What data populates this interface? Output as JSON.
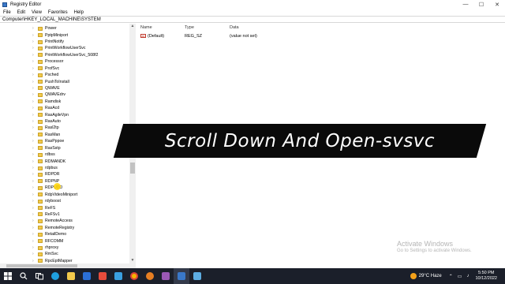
{
  "window": {
    "title": "Registry Editor",
    "controls": {
      "minimize": "—",
      "maximize": "☐",
      "close": "✕"
    }
  },
  "menu": [
    "File",
    "Edit",
    "View",
    "Favorites",
    "Help"
  ],
  "address": "Computer\\HKEY_LOCAL_MACHINE\\SYSTEM",
  "tree": {
    "items": [
      "Power",
      "PptpMiniport",
      "PrintNotify",
      "PrintWorkflowUserSvc",
      "PrintWorkflowUserSvc_508f2",
      "Processor",
      "ProfSvc",
      "Psched",
      "PushToInstall",
      "QWAVE",
      "QWAVEdrv",
      "Ramdisk",
      "RasAcd",
      "RasAgileVpn",
      "RasAuto",
      "Rasl2tp",
      "RasMan",
      "RasPppoe",
      "RasSstp",
      "rdbss",
      "RDMANDK",
      "rdpbus",
      "RDPDR",
      "RDPNP",
      "RDPUDD",
      "RdpVideoMiniport",
      "rdyboost",
      "ReFS",
      "ReFSv1",
      "RemoteAccess",
      "RemoteRegistry",
      "RetailDemo",
      "RFCOMM",
      "rhproxy",
      "RmSvc",
      "RpcEptMapper"
    ]
  },
  "list": {
    "headers": {
      "name": "Name",
      "type": "Type",
      "data": "Data"
    },
    "rows": [
      {
        "name": "(Default)",
        "type": "REG_SZ",
        "data": "(value not set)",
        "icon": "ab"
      }
    ]
  },
  "banner": {
    "text": "Scroll Down And Open-svsvc"
  },
  "watermark": {
    "title": "Activate Windows",
    "subtitle": "Go to Settings to activate Windows."
  },
  "taskbar": {
    "weather": "29°C  Haze",
    "time": "5:50 PM",
    "date": "10/12/2022",
    "icons": [
      "windows-icon",
      "search-icon",
      "task-view-icon",
      "edge-icon",
      "file-explorer-icon",
      "store-icon",
      "mail-icon",
      "photos-icon",
      "chrome-icon",
      "media-icon",
      "app-icon",
      "registry-icon",
      "notepad-icon"
    ]
  }
}
